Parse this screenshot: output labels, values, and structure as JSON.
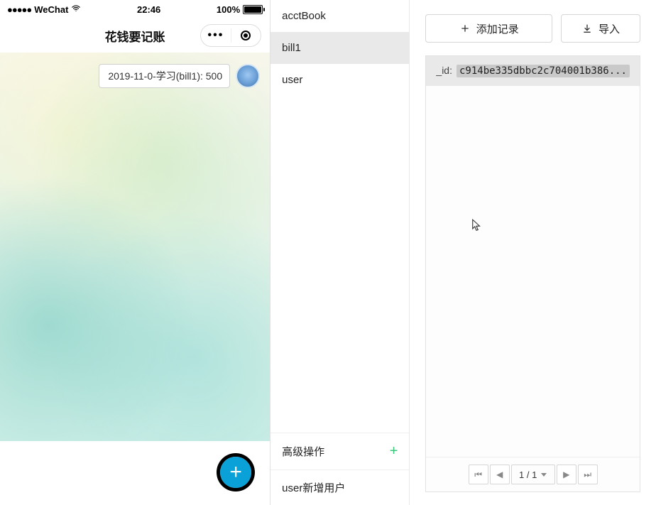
{
  "phone": {
    "carrier": "WeChat",
    "time": "22:46",
    "battery_pct": "100%",
    "app_title": "花钱要记账",
    "message_text": "2019-11-0-学习(bill1): 500"
  },
  "collections": {
    "items": [
      {
        "name": "acctBook",
        "active": false
      },
      {
        "name": "bill1",
        "active": true
      },
      {
        "name": "user",
        "active": false
      }
    ],
    "advanced_title": "高级操作",
    "advanced_items": [
      {
        "label": "user新增用户"
      }
    ]
  },
  "records": {
    "add_label": "添加记录",
    "import_label": "导入",
    "row": {
      "key": "_id:",
      "value": "c914be335dbbc2c704001b386..."
    },
    "page_info": "1 / 1"
  }
}
